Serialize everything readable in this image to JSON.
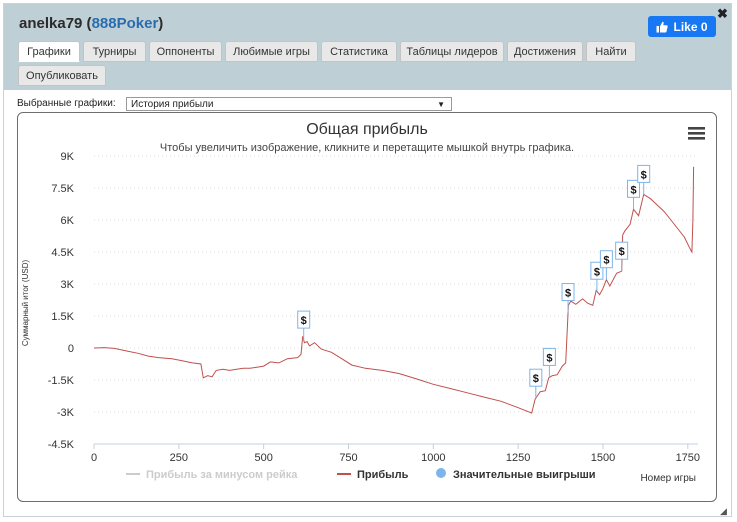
{
  "header": {
    "username": "anelka79",
    "room": "888Poker",
    "like_label": "Like 0",
    "close_icon": "close-icon"
  },
  "tabs": [
    {
      "label": "Графики",
      "active": true
    },
    {
      "label": "Турниры"
    },
    {
      "label": "Оппоненты"
    },
    {
      "label": "Любимые игры"
    },
    {
      "label": "Статистика"
    },
    {
      "label": "Таблицы лидеров"
    },
    {
      "label": "Достижения"
    },
    {
      "label": "Найти"
    },
    {
      "label": "Опубликовать"
    }
  ],
  "selector": {
    "label": "Выбранные графики:",
    "value": "История прибыли"
  },
  "chart_data": {
    "type": "line",
    "title": "Общая прибыль",
    "subtitle": "Чтобы увеличить изображение, кликните и перетащите мышкой внутрь графика.",
    "xlabel": "Номер игры",
    "ylabel": "Суммарный итог (USD)",
    "xlim": [
      0,
      1780
    ],
    "ylim": [
      -4500,
      9000
    ],
    "x_ticks": [
      0,
      250,
      500,
      750,
      1000,
      1250,
      1500,
      1750
    ],
    "x_tick_labels": [
      "0",
      "250",
      "500",
      "750",
      "1000",
      "1250",
      "1500",
      "1750"
    ],
    "y_ticks": [
      -4500,
      -3000,
      -1500,
      0,
      1500,
      3000,
      4500,
      6000,
      7500,
      9000
    ],
    "y_tick_labels": [
      "-4.5K",
      "-3K",
      "-1.5K",
      "0",
      "1.5K",
      "3K",
      "4.5K",
      "6K",
      "7.5K",
      "9K"
    ],
    "grid": "horizontal-dotted",
    "legend_position": "bottom",
    "colors": {
      "profit": "#c0504d",
      "rake": "#cccccc",
      "big_win": "#7cb5ec"
    },
    "series": [
      {
        "name": "Прибыль за минусом рейка",
        "visible": false,
        "points": []
      },
      {
        "name": "Прибыль",
        "points": [
          [
            0,
            0
          ],
          [
            30,
            20
          ],
          [
            60,
            -20
          ],
          [
            100,
            -150
          ],
          [
            130,
            -250
          ],
          [
            160,
            -380
          ],
          [
            190,
            -450
          ],
          [
            230,
            -500
          ],
          [
            260,
            -600
          ],
          [
            290,
            -700
          ],
          [
            315,
            -750
          ],
          [
            322,
            -1400
          ],
          [
            335,
            -1300
          ],
          [
            348,
            -1350
          ],
          [
            360,
            -1050
          ],
          [
            380,
            -1000
          ],
          [
            400,
            -1050
          ],
          [
            420,
            -1000
          ],
          [
            440,
            -950
          ],
          [
            460,
            -950
          ],
          [
            480,
            -900
          ],
          [
            500,
            -850
          ],
          [
            520,
            -650
          ],
          [
            545,
            -700
          ],
          [
            570,
            -500
          ],
          [
            600,
            -450
          ],
          [
            610,
            -300
          ],
          [
            615,
            550
          ],
          [
            620,
            250
          ],
          [
            628,
            300
          ],
          [
            635,
            100
          ],
          [
            650,
            250
          ],
          [
            670,
            -50
          ],
          [
            700,
            -200
          ],
          [
            730,
            -500
          ],
          [
            760,
            -800
          ],
          [
            800,
            -950
          ],
          [
            850,
            -1050
          ],
          [
            900,
            -1200
          ],
          [
            950,
            -1450
          ],
          [
            1000,
            -1700
          ],
          [
            1050,
            -1900
          ],
          [
            1100,
            -2100
          ],
          [
            1150,
            -2300
          ],
          [
            1200,
            -2500
          ],
          [
            1250,
            -2800
          ],
          [
            1290,
            -3050
          ],
          [
            1300,
            -2400
          ],
          [
            1315,
            -2050
          ],
          [
            1330,
            -2000
          ],
          [
            1340,
            -1400
          ],
          [
            1350,
            -1300
          ],
          [
            1365,
            -1250
          ],
          [
            1380,
            -850
          ],
          [
            1390,
            -700
          ],
          [
            1398,
            2000
          ],
          [
            1405,
            2200
          ],
          [
            1420,
            2050
          ],
          [
            1440,
            2300
          ],
          [
            1455,
            2100
          ],
          [
            1470,
            2000
          ],
          [
            1480,
            2700
          ],
          [
            1490,
            2500
          ],
          [
            1500,
            2800
          ],
          [
            1510,
            3200
          ],
          [
            1520,
            2900
          ],
          [
            1540,
            3500
          ],
          [
            1555,
            3600
          ],
          [
            1558,
            5300
          ],
          [
            1565,
            5500
          ],
          [
            1580,
            5800
          ],
          [
            1590,
            6500
          ],
          [
            1605,
            6200
          ],
          [
            1620,
            7200
          ],
          [
            1640,
            7000
          ],
          [
            1660,
            6700
          ],
          [
            1680,
            6400
          ],
          [
            1700,
            6000
          ],
          [
            1720,
            5600
          ],
          [
            1740,
            5200
          ],
          [
            1755,
            4700
          ],
          [
            1762,
            4500
          ],
          [
            1765,
            6000
          ],
          [
            1767,
            8500
          ]
        ]
      }
    ],
    "significant_wins": {
      "name": "Значительные выигрыши",
      "label": "$",
      "x": [
        618,
        1302,
        1342,
        1397,
        1482,
        1510,
        1555,
        1590,
        1620
      ]
    }
  }
}
